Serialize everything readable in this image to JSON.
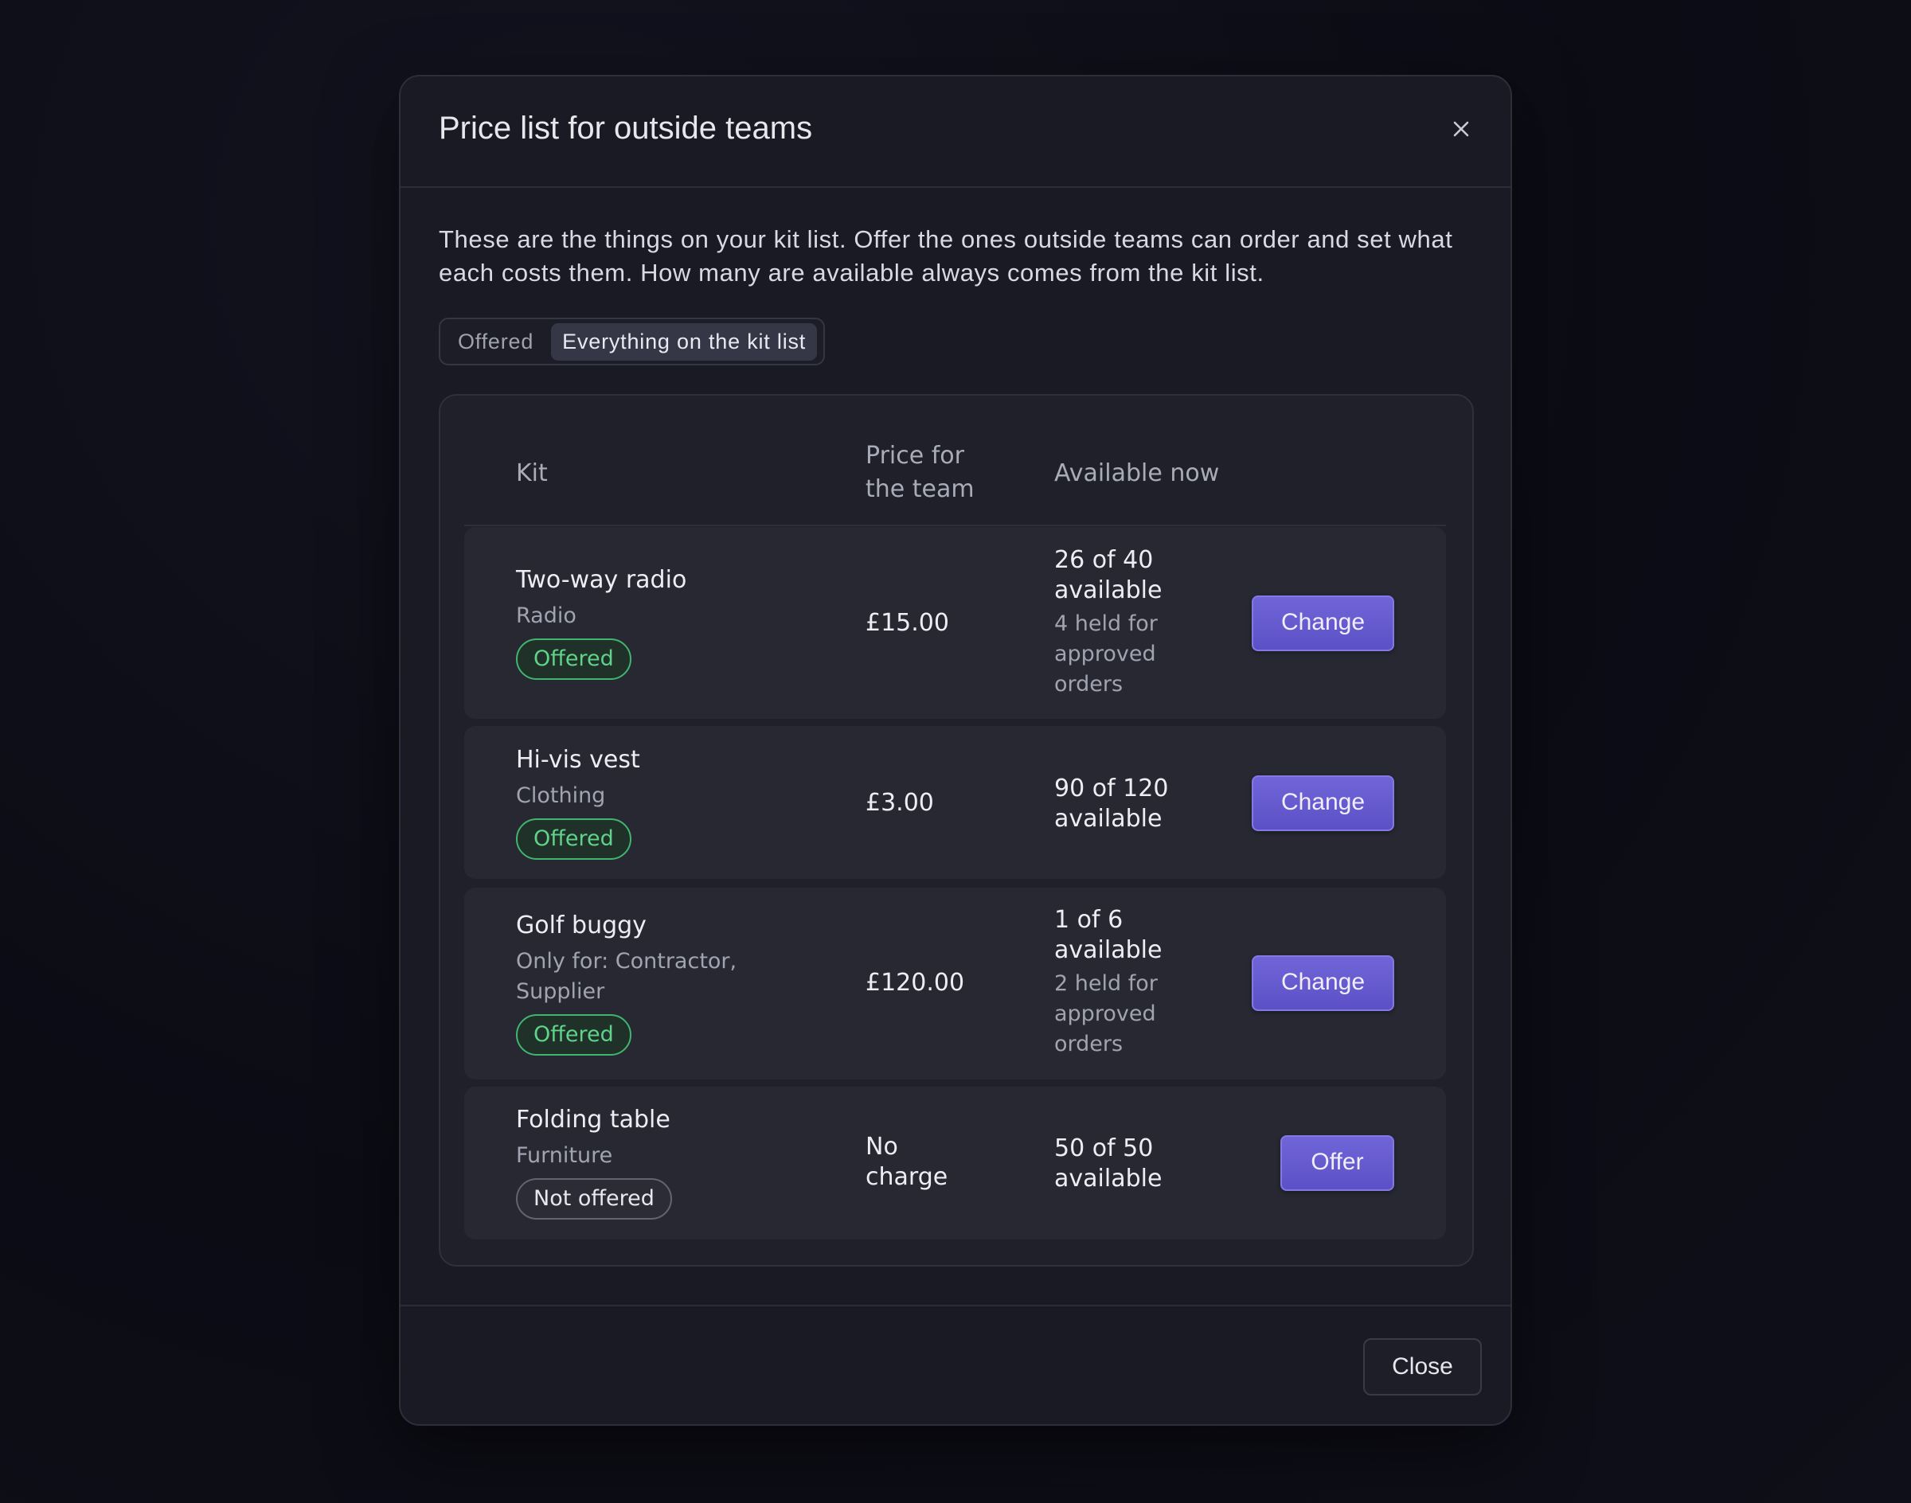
{
  "dialog": {
    "title": "Price list for outside teams",
    "intro": "These are the things on your kit list. Offer the ones outside teams can order and set what each costs them. How many are available always comes from the kit list.",
    "close_label": "Close"
  },
  "filter": {
    "options": [
      "Offered",
      "Everything on the kit list"
    ],
    "selected": "Everything on the kit list"
  },
  "table": {
    "headers": {
      "kit": "Kit",
      "price_line1": "Price for",
      "price_line2": "the team",
      "available": "Available now"
    },
    "rows": [
      {
        "name": "Two-way radio",
        "category_lines": [
          "Radio"
        ],
        "status": "Offered",
        "price_lines": [
          "£15.00"
        ],
        "available_lines": [
          "26 of 40",
          "available"
        ],
        "held_lines": [
          "4 held for",
          "approved",
          "orders"
        ],
        "action": "Change"
      },
      {
        "name": "Hi-vis vest",
        "category_lines": [
          "Clothing"
        ],
        "status": "Offered",
        "price_lines": [
          "£3.00"
        ],
        "available_lines": [
          "90 of 120",
          "available"
        ],
        "held_lines": [],
        "action": "Change"
      },
      {
        "name": "Golf buggy",
        "category_lines": [
          "Only for: Contractor,",
          "Supplier"
        ],
        "status": "Offered",
        "price_lines": [
          "£120.00"
        ],
        "available_lines": [
          "1 of 6",
          "available"
        ],
        "held_lines": [
          "2 held for",
          "approved",
          "orders"
        ],
        "action": "Change"
      },
      {
        "name": "Folding table",
        "category_lines": [
          "Furniture"
        ],
        "status": "Not offered",
        "price_lines": [
          "No",
          "charge"
        ],
        "available_lines": [
          "50 of 50",
          "available"
        ],
        "held_lines": [],
        "action": "Offer"
      }
    ]
  },
  "colors": {
    "accent_button": "#6559cf",
    "offered_badge": "#5fd38a",
    "background": "#0c0c15",
    "dialog": "#191a23"
  },
  "icons": {
    "close": "close-icon"
  }
}
